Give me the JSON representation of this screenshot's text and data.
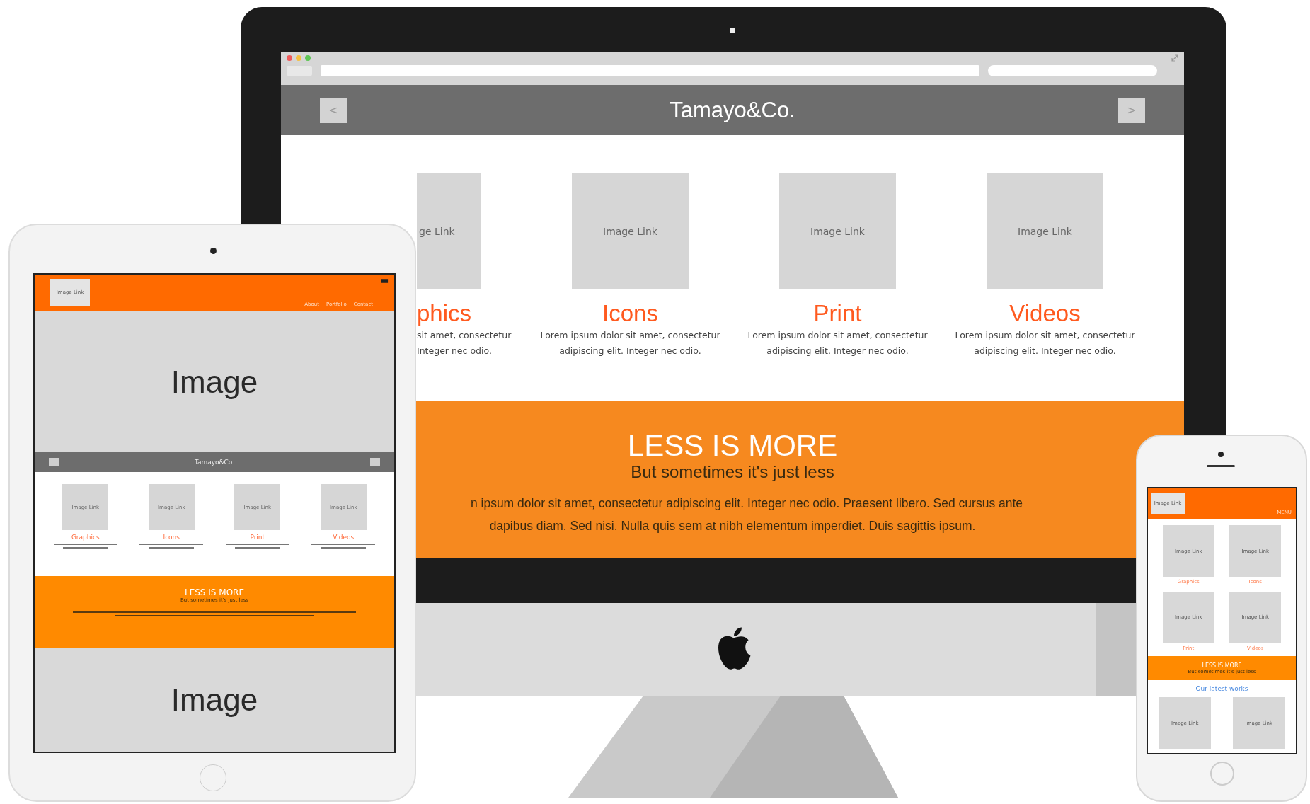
{
  "desktop": {
    "prev_button": "<",
    "site_title": "Tamayo&Co.",
    "next_button": ">",
    "cards": [
      {
        "kind": "clipped",
        "image_label": "ge Link",
        "title": "phics",
        "description_lines": [
          "sit amet, consectetur",
          "Integer nec odio."
        ]
      },
      {
        "kind": "full",
        "image_label": "Image Link",
        "title": "Icons",
        "description_lines": [
          "Lorem ipsum dolor sit amet, consectetur",
          "adipiscing elit. Integer nec odio."
        ]
      },
      {
        "kind": "full",
        "image_label": "Image Link",
        "title": "Print",
        "description_lines": [
          "Lorem ipsum dolor sit amet, consectetur",
          "adipiscing elit. Integer nec odio."
        ]
      },
      {
        "kind": "full",
        "image_label": "Image Link",
        "title": "Videos",
        "description_lines": [
          "Lorem ipsum dolor sit amet, consectetur",
          "adipiscing elit. Integer nec odio."
        ]
      }
    ],
    "banner": {
      "heading": "LESS IS MORE",
      "subheading": "But sometimes it's just less",
      "body_lines": [
        "n ipsum dolor sit amet, consectetur adipiscing elit. Integer nec odio. Praesent libero. Sed cursus ante",
        "dapibus diam. Sed nisi. Nulla quis sem at nibh elementum imperdiet. Duis sagittis ipsum."
      ]
    }
  },
  "tablet": {
    "logo_label": "Image Link",
    "nav": [
      "About",
      "Portfolio",
      "Contact"
    ],
    "hero_label": "Image",
    "bar_title": "Tamayo&Co.",
    "cards": [
      {
        "image_label": "Image Link",
        "title": "Graphics"
      },
      {
        "image_label": "Image Link",
        "title": "Icons"
      },
      {
        "image_label": "Image Link",
        "title": "Print"
      },
      {
        "image_label": "Image Link",
        "title": "Videos"
      }
    ],
    "banner": {
      "heading": "LESS IS MORE",
      "subheading": "But sometimes it's just less"
    },
    "footer_label": "Image"
  },
  "phone": {
    "logo_label": "Image Link",
    "menu": "MENU",
    "cards": [
      {
        "image_label": "Image Link",
        "title": "Graphics"
      },
      {
        "image_label": "Image Link",
        "title": "Icons"
      },
      {
        "image_label": "Image Link",
        "title": "Print"
      },
      {
        "image_label": "Image Link",
        "title": "Videos"
      }
    ],
    "banner": {
      "heading": "LESS IS MORE",
      "subheading": "But sometimes it's just less"
    },
    "section_title": "Our latest works",
    "works": [
      {
        "image_label": "Image Link"
      },
      {
        "image_label": "Image Link"
      }
    ]
  }
}
